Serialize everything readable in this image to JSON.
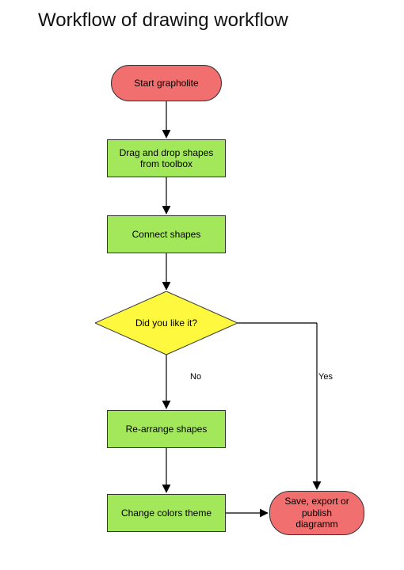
{
  "title": "Workflow of drawing workflow",
  "nodes": {
    "start": {
      "label": "Start grapholite"
    },
    "drag": {
      "label": "Drag and drop shapes\nfrom toolbox"
    },
    "connect": {
      "label": "Connect shapes"
    },
    "decide": {
      "label": "Did you like it?"
    },
    "rearrange": {
      "label": "Re-arrange shapes"
    },
    "theme": {
      "label": "Change colors theme"
    },
    "end": {
      "label": "Save, export or\npublish\ndiagramm"
    }
  },
  "edges": {
    "no": "No",
    "yes": "Yes"
  },
  "colors": {
    "terminator": "#f26f6f",
    "process": "#a2e85a",
    "decision": "#fef83f",
    "stroke": "#333333"
  }
}
